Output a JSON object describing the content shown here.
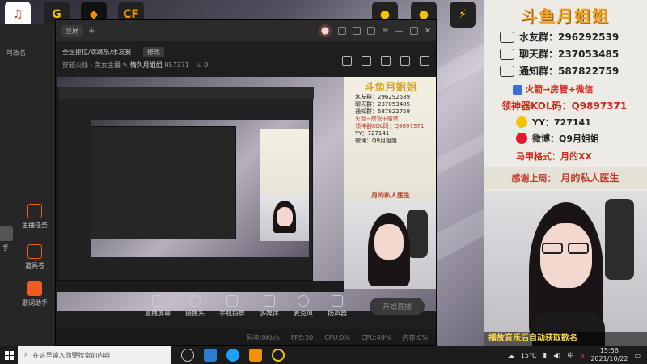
{
  "colors": {
    "accent": "#f0a32a",
    "red_text": "#d12a1a",
    "live_btn": "#3a3a3a"
  },
  "left_strip": {
    "top_label": "可改名",
    "items": [
      {
        "label": "手",
        "icon": "hand-icon"
      },
      {
        "label": "主播任务",
        "icon": "task-icon"
      },
      {
        "label": "道具卷",
        "icon": "prop-icon"
      },
      {
        "label": "歌词助手",
        "icon": "lyrics-icon"
      }
    ]
  },
  "app": {
    "mode_button": "竖屏",
    "category": "全区排位/跳跳乐/水友赛",
    "edit_label": "修改",
    "tag": "穿越火线 - 美女主播",
    "room_name": "情久月姐姐",
    "room_id": "957371",
    "hot": "0",
    "tools": [
      {
        "label": "直播屏幕",
        "icon": "screen-icon"
      },
      {
        "label": "摄像头",
        "icon": "camera-icon"
      },
      {
        "label": "手机投屏",
        "icon": "phone-icon"
      },
      {
        "label": "多媒体",
        "icon": "media-icon"
      },
      {
        "label": "麦克风",
        "icon": "mic-icon"
      },
      {
        "label": "扬声器",
        "icon": "speaker-icon"
      }
    ],
    "start_live": "开始直播",
    "status": {
      "bitrate": "码率:0Kb/s",
      "fps": "FPS:30",
      "cpu_proc": "CPU:0%",
      "cpu": "CPU:49%",
      "mem": "内存:0%"
    }
  },
  "overlay": {
    "title": "斗鱼月姐姐",
    "groups": [
      {
        "label": "水友群：",
        "number": "296292539"
      },
      {
        "label": "聊天群：",
        "number": "237053485"
      },
      {
        "label": "通知群：",
        "number": "587822759"
      }
    ],
    "rocket": "火箭→房管+微信",
    "kol": "领神器KOL码：Q9897371",
    "yy_label": "YY：",
    "yy": "727141",
    "weibo_label": "微博：",
    "weibo": "Q9月姐姐",
    "nick_label": "马甲格式：",
    "nick": "月的XX",
    "thanks_label": "感谢上周：",
    "thanks_name": "月的私人医生",
    "ticker": "播放音乐后自动获取歌名"
  },
  "taskbar": {
    "search_placeholder": "在这里输入你要搜索的内容",
    "temperature": "15°C",
    "lang": "中",
    "time": "15:56",
    "date": "2021/10/22"
  }
}
